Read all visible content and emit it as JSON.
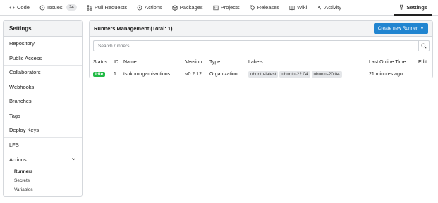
{
  "topnav": {
    "tabs": [
      {
        "label": "Code",
        "icon": "code-icon"
      },
      {
        "label": "Issues",
        "icon": "issue-icon",
        "count": "24"
      },
      {
        "label": "Pull Requests",
        "icon": "pull-request-icon"
      },
      {
        "label": "Actions",
        "icon": "actions-play-icon"
      },
      {
        "label": "Packages",
        "icon": "package-icon"
      },
      {
        "label": "Projects",
        "icon": "project-icon"
      },
      {
        "label": "Releases",
        "icon": "tag-icon"
      },
      {
        "label": "Wiki",
        "icon": "book-icon"
      },
      {
        "label": "Activity",
        "icon": "pulse-icon"
      }
    ],
    "settings_label": "Settings"
  },
  "sidebar": {
    "title": "Settings",
    "items": [
      "Repository",
      "Public Access",
      "Collaborators",
      "Webhooks",
      "Branches",
      "Tags",
      "Deploy Keys",
      "LFS"
    ],
    "group_label": "Actions",
    "sub_items": [
      "Runners",
      "Secrets",
      "Variables"
    ],
    "active_sub": "Runners"
  },
  "panel": {
    "title": "Runners Management (Total: 1)",
    "create_button": "Create new Runner",
    "search_placeholder": "Search runners..."
  },
  "table": {
    "headers": {
      "status": "Status",
      "id": "ID",
      "name": "Name",
      "version": "Version",
      "type": "Type",
      "labels": "Labels",
      "last_online": "Last Online Time",
      "edit": "Edit"
    },
    "rows": [
      {
        "status": "Idle",
        "id": "1",
        "name": "tsukumogami-actions",
        "version": "v0.2.12",
        "type": "Organization",
        "labels": [
          "ubuntu-latest",
          "ubuntu-22.04",
          "ubuntu-20.04"
        ],
        "last_online": "21 minutes ago"
      }
    ]
  },
  "colors": {
    "primary_button": "#2185d0",
    "idle_badge": "#21ba45",
    "label_bg": "#e4e6e9"
  }
}
